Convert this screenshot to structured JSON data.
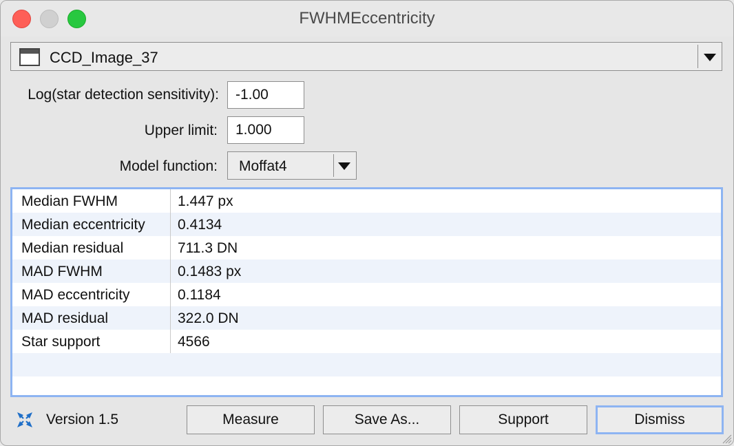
{
  "window": {
    "title": "FWHMEccentricity"
  },
  "view_selector": {
    "value": "CCD_Image_37"
  },
  "form": {
    "sensitivity_label": "Log(star detection sensitivity):",
    "sensitivity_value": "-1.00",
    "upper_limit_label": "Upper limit:",
    "upper_limit_value": "1.000",
    "model_label": "Model function:",
    "model_value": "Moffat4"
  },
  "results": [
    {
      "name": "Median FWHM",
      "value": "1.447 px"
    },
    {
      "name": "Median eccentricity",
      "value": "0.4134"
    },
    {
      "name": "Median residual",
      "value": "711.3 DN"
    },
    {
      "name": "MAD FWHM",
      "value": "0.1483 px"
    },
    {
      "name": "MAD eccentricity",
      "value": "0.1184"
    },
    {
      "name": "MAD residual",
      "value": "322.0 DN"
    },
    {
      "name": "Star support",
      "value": "4566"
    }
  ],
  "footer": {
    "version": "Version 1.5",
    "icon": "pixinsight-script-icon",
    "measure_label": "Measure",
    "save_as_label": "Save As...",
    "support_label": "Support",
    "dismiss_label": "Dismiss"
  },
  "colors": {
    "accent": "#8db4f2",
    "alt_row": "#eef3fb"
  }
}
